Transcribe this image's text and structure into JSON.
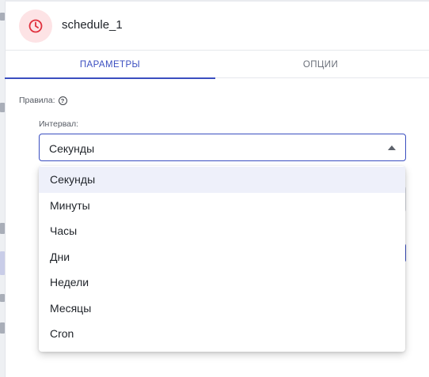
{
  "header": {
    "title": "schedule_1",
    "icon": "clock-icon",
    "icon_color": "#e0303d",
    "icon_bg": "#fde3e5"
  },
  "tabs": [
    {
      "label": "ПАРАМЕТРЫ",
      "active": true
    },
    {
      "label": "ОПЦИИ",
      "active": false
    }
  ],
  "form": {
    "rules_label": "Правила:",
    "interval_label": "Интервал:",
    "interval_value": "Секунды"
  },
  "dropdown": {
    "options": [
      "Секунды",
      "Минуты",
      "Часы",
      "Дни",
      "Недели",
      "Месяцы",
      "Cron"
    ],
    "selected_index": 0
  },
  "colors": {
    "accent": "#3a4ec0",
    "selected_bg": "#eef0fa"
  }
}
